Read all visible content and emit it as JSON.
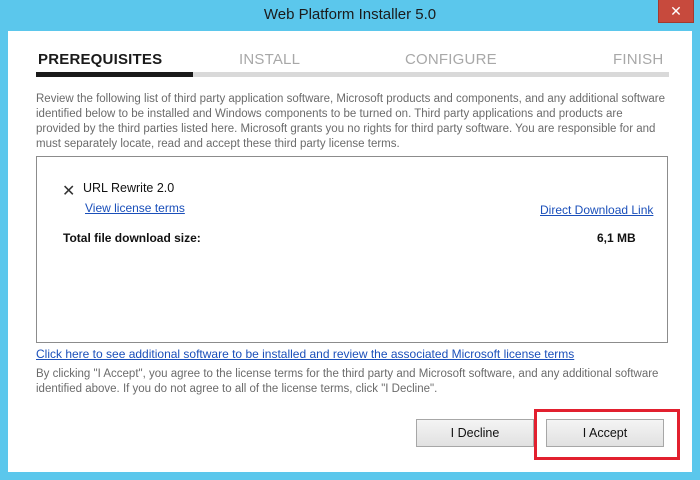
{
  "window": {
    "title": "Web Platform Installer 5.0",
    "close_glyph": "✕"
  },
  "steps": [
    {
      "label": "PREREQUISITES",
      "active": true
    },
    {
      "label": "INSTALL",
      "active": false
    },
    {
      "label": "CONFIGURE",
      "active": false
    },
    {
      "label": "FINISH",
      "active": false
    }
  ],
  "intro_text": "Review the following list of third party application software, Microsoft products and components, and any additional software identified below to be installed and Windows components to be turned on.  Third party applications and products are provided by the third parties listed here.  Microsoft grants you no rights for third party software.  You are responsible for and must separately locate, read and accept these third party license terms.",
  "item": {
    "status_icon": "x-icon",
    "status_glyph": "✕",
    "name": "URL Rewrite 2.0",
    "license_link": "View license terms",
    "download_link": "Direct Download Link"
  },
  "total": {
    "label": "Total file download size:",
    "value": "6,1 MB"
  },
  "additional_link": "Click here to see additional software to be installed and review the associated Microsoft license terms",
  "accept_note": "By clicking \"I Accept\", you agree to the license terms for the third party and Microsoft software, and any additional software identified above.  If you do not agree to all of the license terms, click \"I Decline\".",
  "buttons": {
    "decline": "I Decline",
    "accept": "I Accept"
  },
  "colors": {
    "window_frame": "#5bc7ec",
    "highlight_border": "#e2202f",
    "link": "#1a4fba"
  }
}
